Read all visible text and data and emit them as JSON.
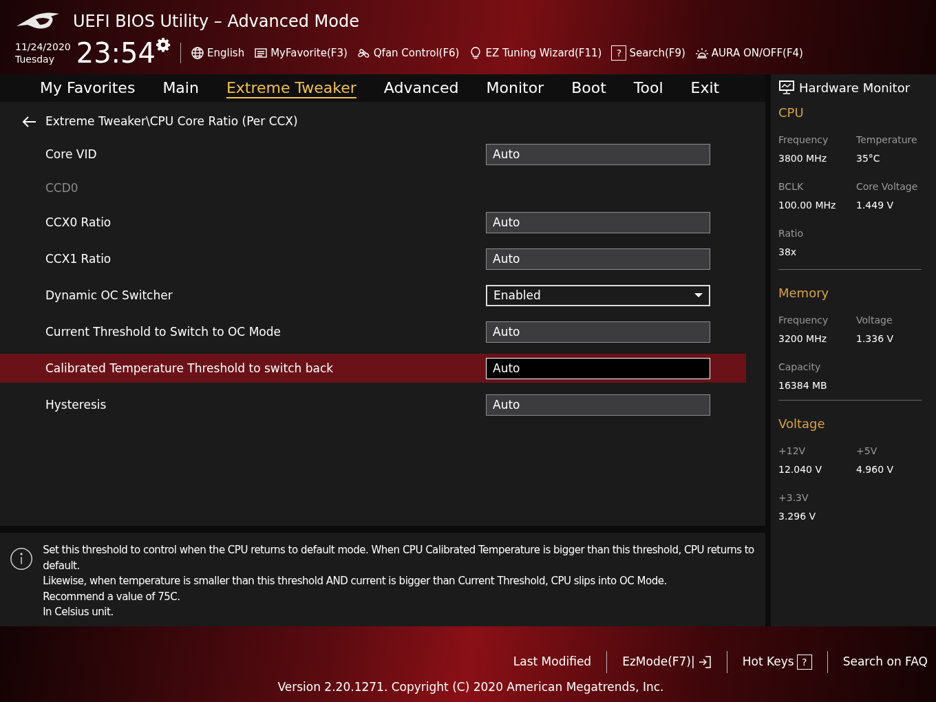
{
  "header": {
    "title": "UEFI BIOS Utility – Advanced Mode",
    "date": "11/24/2020",
    "day": "Tuesday",
    "time": "23:54",
    "tools": [
      {
        "label": "English",
        "kind": "globe"
      },
      {
        "label": "MyFavorite(F3)",
        "kind": "list"
      },
      {
        "label": "Qfan Control(F6)",
        "kind": "fan"
      },
      {
        "label": "EZ Tuning Wizard(F11)",
        "kind": "bulb"
      },
      {
        "label": "Search(F9)",
        "kind": "help",
        "key_glyph": "?"
      },
      {
        "label": "AURA ON/OFF(F4)",
        "kind": "aura"
      }
    ]
  },
  "tabs": [
    {
      "label": "My Favorites",
      "selected": false
    },
    {
      "label": "Main",
      "selected": false
    },
    {
      "label": "Extreme Tweaker",
      "selected": true
    },
    {
      "label": "Advanced",
      "selected": false
    },
    {
      "label": "Monitor",
      "selected": false
    },
    {
      "label": "Boot",
      "selected": false
    },
    {
      "label": "Tool",
      "selected": false
    },
    {
      "label": "Exit",
      "selected": false
    }
  ],
  "breadcrumb": "Extreme Tweaker\\CPU Core Ratio (Per CCX)",
  "settings": [
    {
      "kind": "field",
      "label": "Core VID",
      "value": "Auto",
      "selected": false
    },
    {
      "kind": "group",
      "label": "CCD0"
    },
    {
      "kind": "field",
      "label": "CCX0 Ratio",
      "value": "Auto",
      "selected": false
    },
    {
      "kind": "field",
      "label": "CCX1 Ratio",
      "value": "Auto",
      "selected": false
    },
    {
      "kind": "dropdown",
      "label": "Dynamic OC Switcher",
      "value": "Enabled",
      "selected": false
    },
    {
      "kind": "field",
      "label": "Current Threshold to Switch to OC Mode",
      "value": "Auto",
      "selected": false
    },
    {
      "kind": "field",
      "label": "Calibrated Temperature Threshold to switch back",
      "value": "Auto",
      "selected": true
    },
    {
      "kind": "field",
      "label": "Hysteresis",
      "value": "Auto",
      "selected": false
    }
  ],
  "help_lines": [
    "Set this threshold to control when the CPU returns to default mode. When CPU Calibrated Temperature is bigger than this threshold, CPU returns to default.",
    "Likewise, when temperature is smaller than this threshold AND current is bigger than Current Threshold, CPU slips into OC Mode.",
    "Recommend a value of 75C.",
    "In Celsius unit."
  ],
  "hardware_monitor": {
    "title": "Hardware Monitor",
    "sections": [
      {
        "title": "CPU",
        "items": [
          {
            "label": "Frequency",
            "value": "3800 MHz"
          },
          {
            "label": "Temperature",
            "value": "35°C"
          },
          {
            "label": "BCLK",
            "value": "100.00 MHz"
          },
          {
            "label": "Core Voltage",
            "value": "1.449 V"
          },
          {
            "label": "Ratio",
            "value": "38x"
          }
        ]
      },
      {
        "title": "Memory",
        "items": [
          {
            "label": "Frequency",
            "value": "3200 MHz"
          },
          {
            "label": "Voltage",
            "value": "1.336 V"
          },
          {
            "label": "Capacity",
            "value": "16384 MB"
          }
        ]
      },
      {
        "title": "Voltage",
        "items": [
          {
            "label": "+12V",
            "value": "12.040 V"
          },
          {
            "label": "+5V",
            "value": "4.960 V"
          },
          {
            "label": "+3.3V",
            "value": "3.296 V"
          }
        ]
      }
    ]
  },
  "footer": {
    "links": [
      {
        "label": "Last Modified",
        "kind": "text"
      },
      {
        "label": "EzMode(F7)|",
        "kind": "exit"
      },
      {
        "label": "Hot Keys",
        "kind": "help",
        "key_glyph": "?"
      },
      {
        "label": "Search on FAQ",
        "kind": "text"
      }
    ],
    "version": "Version 2.20.1271. Copyright (C) 2020 American Megatrends, Inc."
  }
}
